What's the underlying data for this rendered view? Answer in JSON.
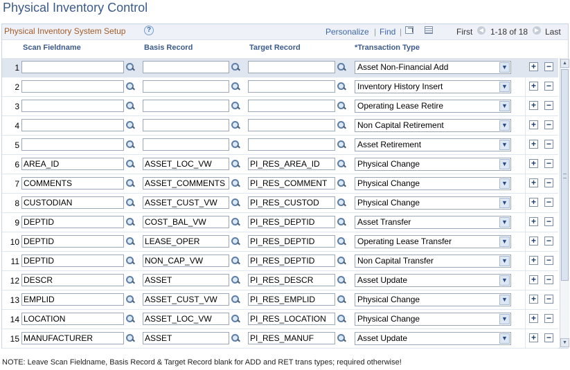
{
  "page": {
    "title": "Physical Inventory Control"
  },
  "grid": {
    "title": "Physical Inventory System Setup",
    "help_label": "?",
    "toolbar": {
      "personalize": "Personalize",
      "separator": "|",
      "find": "Find",
      "view_all_icon": "view-all-icon",
      "download_icon": "spreadsheet-download-icon"
    },
    "nav": {
      "first": "First",
      "range": "1-18 of 18",
      "last": "Last"
    },
    "columns": {
      "scan": "Scan Fieldname",
      "basis": "Basis Record",
      "target": "Target Record",
      "trans": "*Transaction Type"
    },
    "rows": [
      {
        "num": "1",
        "scan": "",
        "basis": "",
        "target": "",
        "trans": "Asset Non-Financial Add"
      },
      {
        "num": "2",
        "scan": "",
        "basis": "",
        "target": "",
        "trans": "Inventory History Insert"
      },
      {
        "num": "3",
        "scan": "",
        "basis": "",
        "target": "",
        "trans": "Operating Lease Retire"
      },
      {
        "num": "4",
        "scan": "",
        "basis": "",
        "target": "",
        "trans": "Non Capital Retirement"
      },
      {
        "num": "5",
        "scan": "",
        "basis": "",
        "target": "",
        "trans": "Asset Retirement"
      },
      {
        "num": "6",
        "scan": "AREA_ID",
        "basis": "ASSET_LOC_VW",
        "target": "PI_RES_AREA_ID",
        "trans": "Physical Change"
      },
      {
        "num": "7",
        "scan": "COMMENTS",
        "basis": "ASSET_COMMENTS",
        "target": "PI_RES_COMMENT",
        "trans": "Physical Change"
      },
      {
        "num": "8",
        "scan": "CUSTODIAN",
        "basis": "ASSET_CUST_VW",
        "target": "PI_RES_CUSTOD",
        "trans": "Physical Change"
      },
      {
        "num": "9",
        "scan": "DEPTID",
        "basis": "COST_BAL_VW",
        "target": "PI_RES_DEPTID",
        "trans": "Asset Transfer"
      },
      {
        "num": "10",
        "scan": "DEPTID",
        "basis": "LEASE_OPER",
        "target": "PI_RES_DEPTID",
        "trans": "Operating Lease Transfer"
      },
      {
        "num": "11",
        "scan": "DEPTID",
        "basis": "NON_CAP_VW",
        "target": "PI_RES_DEPTID",
        "trans": "Non Capital Transfer"
      },
      {
        "num": "12",
        "scan": "DESCR",
        "basis": "ASSET",
        "target": "PI_RES_DESCR",
        "trans": "Asset Update"
      },
      {
        "num": "13",
        "scan": "EMPLID",
        "basis": "ASSET_CUST_VW",
        "target": "PI_RES_EMPLID",
        "trans": "Physical Change"
      },
      {
        "num": "14",
        "scan": "LOCATION",
        "basis": "ASSET_LOC_VW",
        "target": "PI_RES_LOCATION",
        "trans": "Physical Change"
      },
      {
        "num": "15",
        "scan": "MANUFACTURER",
        "basis": "ASSET",
        "target": "PI_RES_MANUF",
        "trans": "Asset Update"
      }
    ],
    "add_label": "+",
    "delete_label": "−"
  },
  "footnote": "NOTE: Leave Scan Fieldname, Basis Record & Target Record blank for ADD and RET trans types; required otherwise!"
}
